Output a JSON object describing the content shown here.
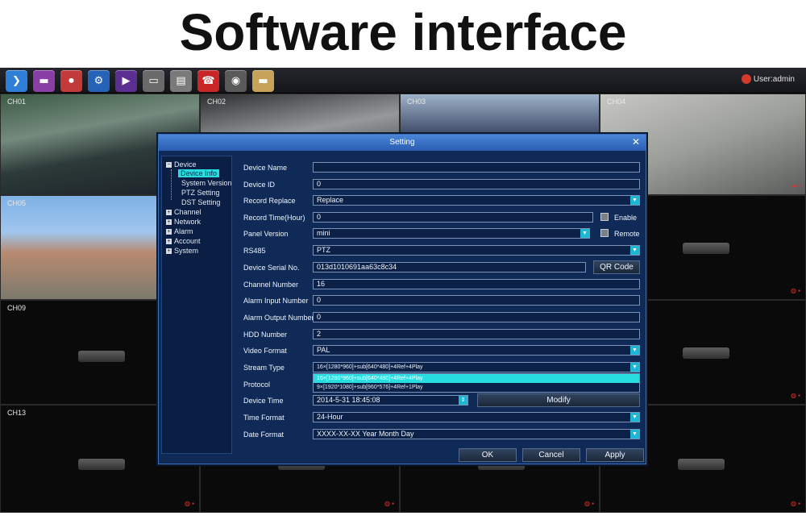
{
  "banner": {
    "title": "Software interface"
  },
  "toolbar": {
    "buttons": [
      {
        "name": "menu-icon",
        "glyph": "❯",
        "color": "#2f7fd8"
      },
      {
        "name": "monitor-icon",
        "glyph": "▬",
        "color": "#8a3fa7"
      },
      {
        "name": "record-icon",
        "glyph": "⏺",
        "color": "#c33a3a"
      },
      {
        "name": "settings-icon",
        "glyph": "⚙",
        "color": "#2563b8"
      },
      {
        "name": "playback-icon",
        "glyph": "▶",
        "color": "#5b2f92"
      },
      {
        "name": "backup-icon",
        "glyph": "▭",
        "color": "#6a6a6a"
      },
      {
        "name": "info-icon",
        "glyph": "▤",
        "color": "#7a7a7a"
      },
      {
        "name": "alarm-icon",
        "glyph": "☎",
        "color": "#c92727"
      },
      {
        "name": "camera-icon",
        "glyph": "◉",
        "color": "#5a5a5a"
      },
      {
        "name": "folder-icon",
        "glyph": "▬",
        "color": "#c7a35a"
      }
    ],
    "user": "User:admin"
  },
  "channels": [
    "CH01",
    "CH02",
    "CH03",
    "CH04",
    "CH05",
    "CH09",
    "CH13"
  ],
  "dialog": {
    "title": "Setting",
    "close": "✕",
    "tree": {
      "device": "Device",
      "device_children": [
        "Device Info",
        "System Version",
        "PTZ Setting",
        "DST Setting"
      ],
      "others": [
        "Channel",
        "Network",
        "Alarm",
        "Account",
        "System"
      ]
    },
    "labels": {
      "device_name": "Device Name",
      "device_id": "Device ID",
      "record_replace": "Record Replace",
      "record_time": "Record Time(Hour)",
      "panel_version": "Panel Version",
      "rs485": "RS485",
      "serial_no": "Device Serial No.",
      "channel_number": "Channel Number",
      "alarm_input": "Alarm Input Number",
      "alarm_output": "Alarm Output Number",
      "hdd_number": "HDD Number",
      "video_format": "Video Format",
      "stream_type": "Stream Type",
      "protocol": "Protocol",
      "device_time": "Device Time",
      "time_format": "Time Format",
      "date_format": "Date Format"
    },
    "values": {
      "device_name": "",
      "device_id": "0",
      "record_replace": "Replace",
      "record_time": "0",
      "panel_version": "mini",
      "rs485": "PTZ",
      "serial_no": "013d1010691aa63c8c34",
      "channel_number": "16",
      "alarm_input": "0",
      "alarm_output": "0",
      "hdd_number": "2",
      "video_format": "PAL",
      "stream_type": "16×[1280*960]+sub[640*480]+4Ref+4Play",
      "device_time": "2014-5-31 18:45:08",
      "time_format": "24-Hour",
      "date_format": "XXXX-XX-XX Year Month Day"
    },
    "stream_options": [
      "16×[1280*960]+sub[640*480]+4Ref+4Play",
      "9×[1920*1080]+sub[960*576]+4Ref+1Play"
    ],
    "checkboxes": {
      "enable": "Enable",
      "remote": "Remote"
    },
    "buttons": {
      "qr_code": "QR Code",
      "modify": "Modify",
      "ok": "OK",
      "cancel": "Cancel",
      "apply": "Apply"
    }
  }
}
